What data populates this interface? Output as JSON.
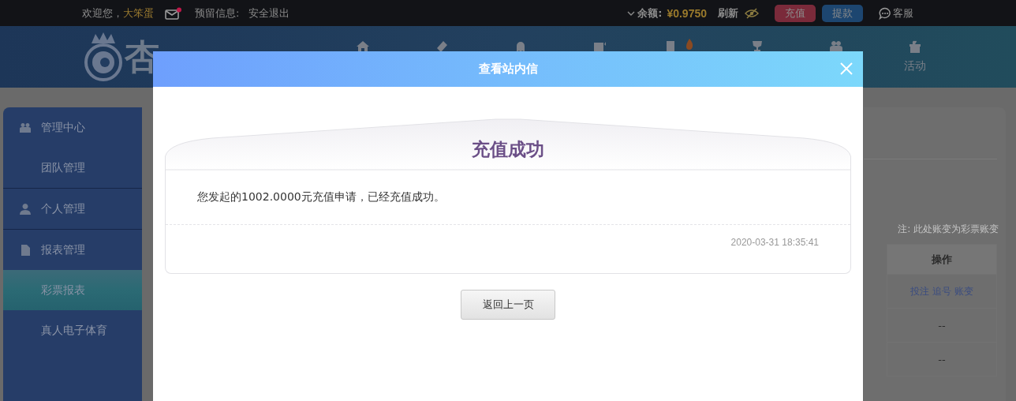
{
  "top_bar": {
    "greeting": "欢迎您，",
    "username": "大笨蛋",
    "mail_unread": true,
    "reserved_info_label": "预留信息:",
    "logout": "安全退出",
    "balance_label": "余额:",
    "balance": "¥0.9750",
    "refresh": "刷新",
    "recharge": "充值",
    "withdraw": "提款",
    "support": "客服"
  },
  "header": {
    "logo_text": "杏",
    "nav": [
      {
        "kind": "home"
      },
      {
        "kind": "ticket"
      },
      {
        "kind": "ghost"
      },
      {
        "kind": "slot"
      },
      {
        "kind": "card",
        "hot": true
      },
      {
        "kind": "trophy"
      },
      {
        "kind": "people"
      },
      {
        "kind": "gift",
        "label": "活动"
      }
    ]
  },
  "sidebar": {
    "items": [
      {
        "kind": "group",
        "label": "管理中心",
        "selected": false
      },
      {
        "kind": "link",
        "label": "团队管理",
        "selected": false
      },
      {
        "kind": "group",
        "label": "个人管理",
        "selected": false
      },
      {
        "kind": "group",
        "label": "报表管理",
        "selected": false
      },
      {
        "kind": "link",
        "label": "彩票报表",
        "selected": true
      },
      {
        "kind": "link",
        "label": "真人电子体育",
        "selected": false
      }
    ]
  },
  "content": {
    "note": "注: 此处账变为彩票账变",
    "table": {
      "columns": [
        "操作"
      ],
      "rows": [
        {
          "kind": "links",
          "links": [
            "投注",
            "追号",
            "账变"
          ]
        },
        {
          "kind": "text",
          "text": "--"
        },
        {
          "kind": "text",
          "text": "--"
        }
      ]
    }
  },
  "modal": {
    "title": "查看站内信",
    "message_title": "充值成功",
    "message_body": "您发起的1002.0000元充值申请，已经充值成功。",
    "date": "2020-03-31 18:35:41",
    "back_button": "返回上一页"
  }
}
